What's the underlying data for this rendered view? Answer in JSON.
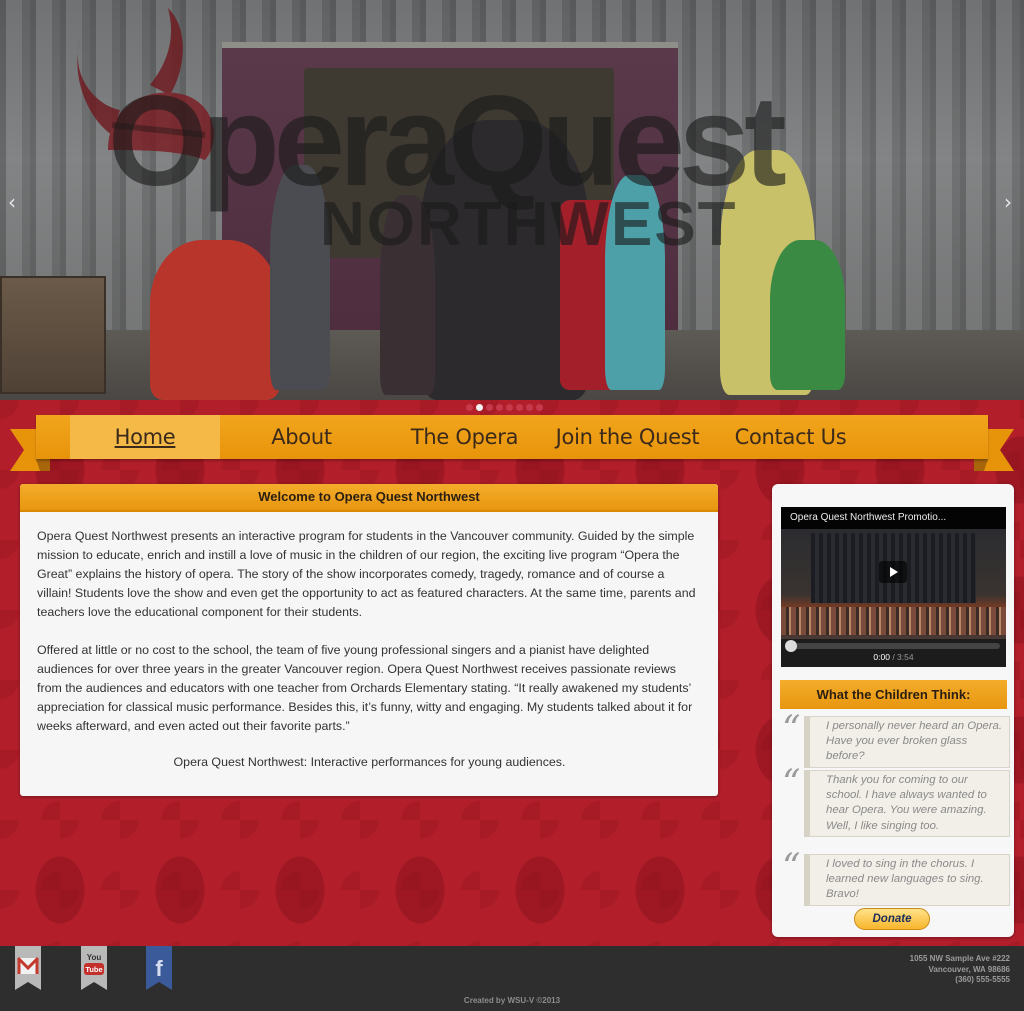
{
  "hero": {
    "logo_line1": "OperaQuest",
    "logo_line2": "NORTHWEST",
    "prev_arrow": "‹",
    "next_arrow": "›",
    "slide_count": 8,
    "active_slide": 2
  },
  "nav": {
    "items": [
      {
        "label": "Home",
        "active": true
      },
      {
        "label": "About",
        "active": false
      },
      {
        "label": "The Opera",
        "active": false
      },
      {
        "label": "Join the Quest",
        "active": false
      },
      {
        "label": "Contact Us",
        "active": false
      }
    ]
  },
  "main": {
    "title": "Welcome to Opera Quest Northwest",
    "paragraph1": "Opera Quest Northwest presents an interactive program for students in the Vancouver community. Guided by the simple mission to educate, enrich and instill a love of music in the children of our region, the exciting live program “Opera the Great” explains the history of opera. The story of the show incorporates comedy, tragedy, romance and of course a villain! Students love the show and even get the opportunity to act as featured characters.  At the same time, parents and teachers love the educational component for their students.",
    "paragraph2": "Offered at little or no cost to the school, the team of five young professional singers and a pianist have delighted audiences for over three years in the greater Vancouver region. Opera Quest Northwest receives passionate reviews from the audiences and educators with one teacher from Orchards Elementary stating. “It really awakened my students’ appreciation for classical music performance.  Besides this, it’s funny, witty and engaging.  My students talked about it for weeks afterward, and even acted out their favorite parts.”",
    "tagline": "Opera Quest Northwest: Interactive performances for young audiences."
  },
  "sidebar": {
    "video": {
      "title": "Opera Quest Northwest Promotio...",
      "current_time": "0:00",
      "separator": " / ",
      "duration": "3:54",
      "progress": 0
    },
    "kids_title": "What the Children Think:",
    "quote_mark": "“",
    "quotes": [
      "I personally never heard an Opera. Have you ever broken glass before?",
      "Thank you for coming to our school. I have always wanted to hear Opera. You were amazing. Well, I like singing too.",
      "I loved to sing in the chorus. I learned new languages to sing. Bravo!"
    ],
    "donate_label": "Donate"
  },
  "footer": {
    "social": [
      {
        "icon": "gmail-icon",
        "label": "M"
      },
      {
        "icon": "youtube-icon",
        "label": "You Tube"
      },
      {
        "icon": "facebook-icon",
        "label": "f"
      }
    ],
    "address_line1": "1055 NW Sample Ave #222",
    "address_line2": "Vancouver, WA 98686",
    "phone": "(360) 555-5555",
    "credit": "Created by WSU-V ©2013"
  },
  "colors": {
    "brand_red": "#b21f2b",
    "ribbon_orange": "#f1a51c",
    "active_nav": "#f5b947",
    "footer_bg": "#2e2e2e"
  }
}
